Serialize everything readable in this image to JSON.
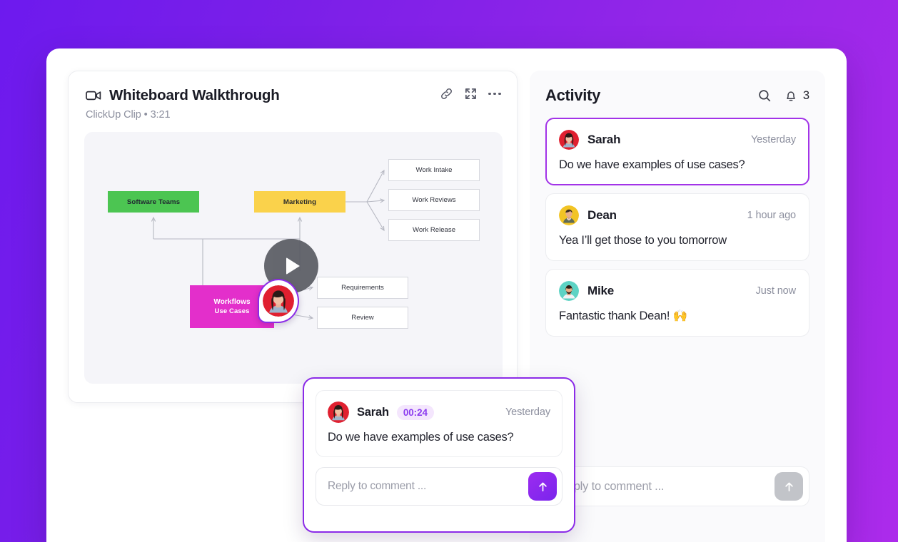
{
  "clip": {
    "icon": "video-camera-icon",
    "title": "Whiteboard Walkthrough",
    "subtitle": "ClickUp Clip • 3:21",
    "actions": [
      {
        "name": "link-icon",
        "label": "Copy link"
      },
      {
        "name": "expand-icon",
        "label": "Fullscreen"
      },
      {
        "name": "more-options-icon",
        "label": "More"
      }
    ]
  },
  "whiteboard": {
    "nodes": [
      {
        "id": "software-teams",
        "label": "Software Teams",
        "color": "#4CC552"
      },
      {
        "id": "marketing",
        "label": "Marketing",
        "color": "#FAD24B"
      },
      {
        "id": "workflows",
        "label_line1": "Workflows",
        "label_line2": "Use Cases",
        "color": "#E32FCB"
      }
    ],
    "boxes": [
      {
        "id": "work-intake",
        "label": "Work Intake"
      },
      {
        "id": "work-reviews",
        "label": "Work Reviews"
      },
      {
        "id": "work-release",
        "label": "Work Release"
      },
      {
        "id": "requirements",
        "label": "Requirements"
      },
      {
        "id": "review",
        "label": "Review"
      }
    ],
    "play_button": "play-icon",
    "pin_user": "Sarah"
  },
  "comment_popup": {
    "author": "Sarah",
    "timecode": "00:24",
    "when": "Yesterday",
    "text": "Do we have examples of use cases?",
    "reply_placeholder": "Reply to comment ...",
    "reply_value": "",
    "send_icon": "arrow-up-icon"
  },
  "activity": {
    "title": "Activity",
    "search_icon": "search-icon",
    "bell_icon": "bell-icon",
    "notification_count": "3",
    "items": [
      {
        "author": "Sarah",
        "when": "Yesterday",
        "text": "Do we have examples of use cases?",
        "selected": true,
        "avatar": "sarah"
      },
      {
        "author": "Dean",
        "when": "1 hour ago",
        "text": "Yea I’ll get those to you tomorrow",
        "selected": false,
        "avatar": "dean"
      },
      {
        "author": "Mike",
        "when": "Just now",
        "text": "Fantastic thank Dean! 🙌",
        "selected": false,
        "avatar": "mike"
      }
    ],
    "reply_placeholder": "Reply to comment ...",
    "reply_value": "",
    "send_icon": "arrow-up-icon"
  },
  "colors": {
    "background_gradient_start": "#6D1AEE",
    "background_gradient_end": "#AC2BEB",
    "accent_purple": "#8B2BE8",
    "selected_border": "#A233E8",
    "badge_bg": "#F4E6FD",
    "badge_text": "#8B3BEF",
    "node_green": "#4CC552",
    "node_yellow": "#FAD24B",
    "node_pink": "#E32FCB",
    "canvas_bg": "#F5F5F9"
  }
}
